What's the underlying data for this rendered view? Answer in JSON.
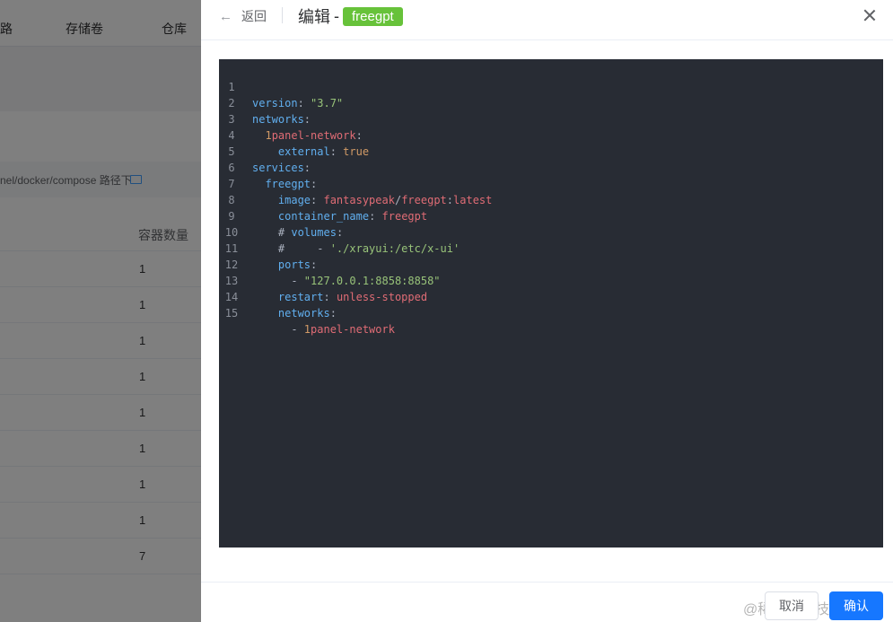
{
  "background": {
    "tabs": [
      "路",
      "存储卷",
      "仓库"
    ],
    "path_text": "nel/docker/compose 路径下",
    "table_header": "容器数量",
    "row_counts": [
      "1",
      "1",
      "1",
      "1",
      "1",
      "1",
      "1",
      "1",
      "7"
    ]
  },
  "drawer": {
    "back_label": "返回",
    "title": "编辑",
    "title_separator": "-",
    "name_tag": "freegpt",
    "cancel_label": "取消",
    "confirm_label": "确认",
    "watermark": "@稀土掘金技术社区"
  },
  "editor": {
    "lines": [
      {
        "no": "1",
        "text": "version: \"3.7\""
      },
      {
        "no": "2",
        "text": "networks:"
      },
      {
        "no": "3",
        "text": "  1panel-network:"
      },
      {
        "no": "4",
        "text": "    external: true"
      },
      {
        "no": "5",
        "text": "services:"
      },
      {
        "no": "6",
        "text": "  freegpt:"
      },
      {
        "no": "7",
        "text": "    image: fantasypeak/freegpt:latest"
      },
      {
        "no": "8",
        "text": "    container_name: freegpt"
      },
      {
        "no": "9",
        "text": "    # volumes:"
      },
      {
        "no": "10",
        "text": "    #     - './xrayui:/etc/x-ui'"
      },
      {
        "no": "11",
        "text": "    ports:"
      },
      {
        "no": "12",
        "text": "      - \"127.0.0.1:8858:8858\""
      },
      {
        "no": "13",
        "text": "    restart: unless-stopped"
      },
      {
        "no": "14",
        "text": "    networks:"
      },
      {
        "no": "15",
        "text": "      - 1panel-network"
      }
    ]
  },
  "colors": {
    "tag_green": "#67c23a",
    "primary_blue": "#1677ff",
    "editor_bg": "#282c34"
  }
}
